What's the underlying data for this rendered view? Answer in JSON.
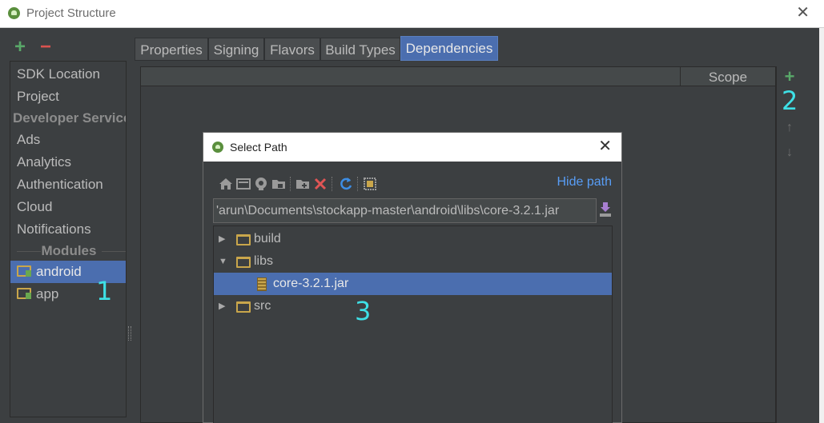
{
  "window": {
    "title": "Project Structure"
  },
  "left_toolbar": {
    "add": "+",
    "remove": "−"
  },
  "sidebar": {
    "items": [
      {
        "label": "SDK Location",
        "type": "item"
      },
      {
        "label": "Project",
        "type": "item"
      },
      {
        "label": "Developer Service",
        "type": "section"
      },
      {
        "label": "Ads",
        "type": "item"
      },
      {
        "label": "Analytics",
        "type": "item"
      },
      {
        "label": "Authentication",
        "type": "item"
      },
      {
        "label": "Cloud",
        "type": "item"
      },
      {
        "label": "Notifications",
        "type": "item"
      },
      {
        "label": "Modules",
        "type": "section"
      },
      {
        "label": "android",
        "type": "module",
        "selected": true
      },
      {
        "label": "app",
        "type": "module"
      }
    ]
  },
  "tabs": [
    {
      "label": "Properties"
    },
    {
      "label": "Signing"
    },
    {
      "label": "Flavors"
    },
    {
      "label": "Build Types"
    },
    {
      "label": "Dependencies",
      "active": true
    }
  ],
  "dependencies_table": {
    "columns": [
      "",
      "Scope"
    ]
  },
  "side_tools": {
    "add": "+",
    "up": "↑",
    "down": "↓"
  },
  "annotations": [
    "1",
    "2",
    "3"
  ],
  "dialog": {
    "title": "Select Path",
    "hide_path_link": "Hide path",
    "path_value": "'arun\\Documents\\stockapp-master\\android\\libs\\core-3.2.1.jar",
    "toolbar_icons": [
      "home-icon",
      "desktop-icon",
      "project-icon",
      "module-folder-icon",
      "new-folder-icon",
      "delete-icon",
      "refresh-icon",
      "show-hidden-icon"
    ],
    "tree": [
      {
        "label": "build",
        "kind": "folder",
        "expanded": false,
        "depth": 0
      },
      {
        "label": "libs",
        "kind": "folder",
        "expanded": true,
        "depth": 0
      },
      {
        "label": "core-3.2.1.jar",
        "kind": "jar",
        "depth": 1,
        "selected": true
      },
      {
        "label": "src",
        "kind": "folder",
        "expanded": false,
        "depth": 0
      }
    ]
  },
  "colors": {
    "accent": "#4b6eaf",
    "link": "#589df6",
    "add": "#59a869",
    "remove": "#d9534f",
    "annotation": "#3ee0e6"
  }
}
